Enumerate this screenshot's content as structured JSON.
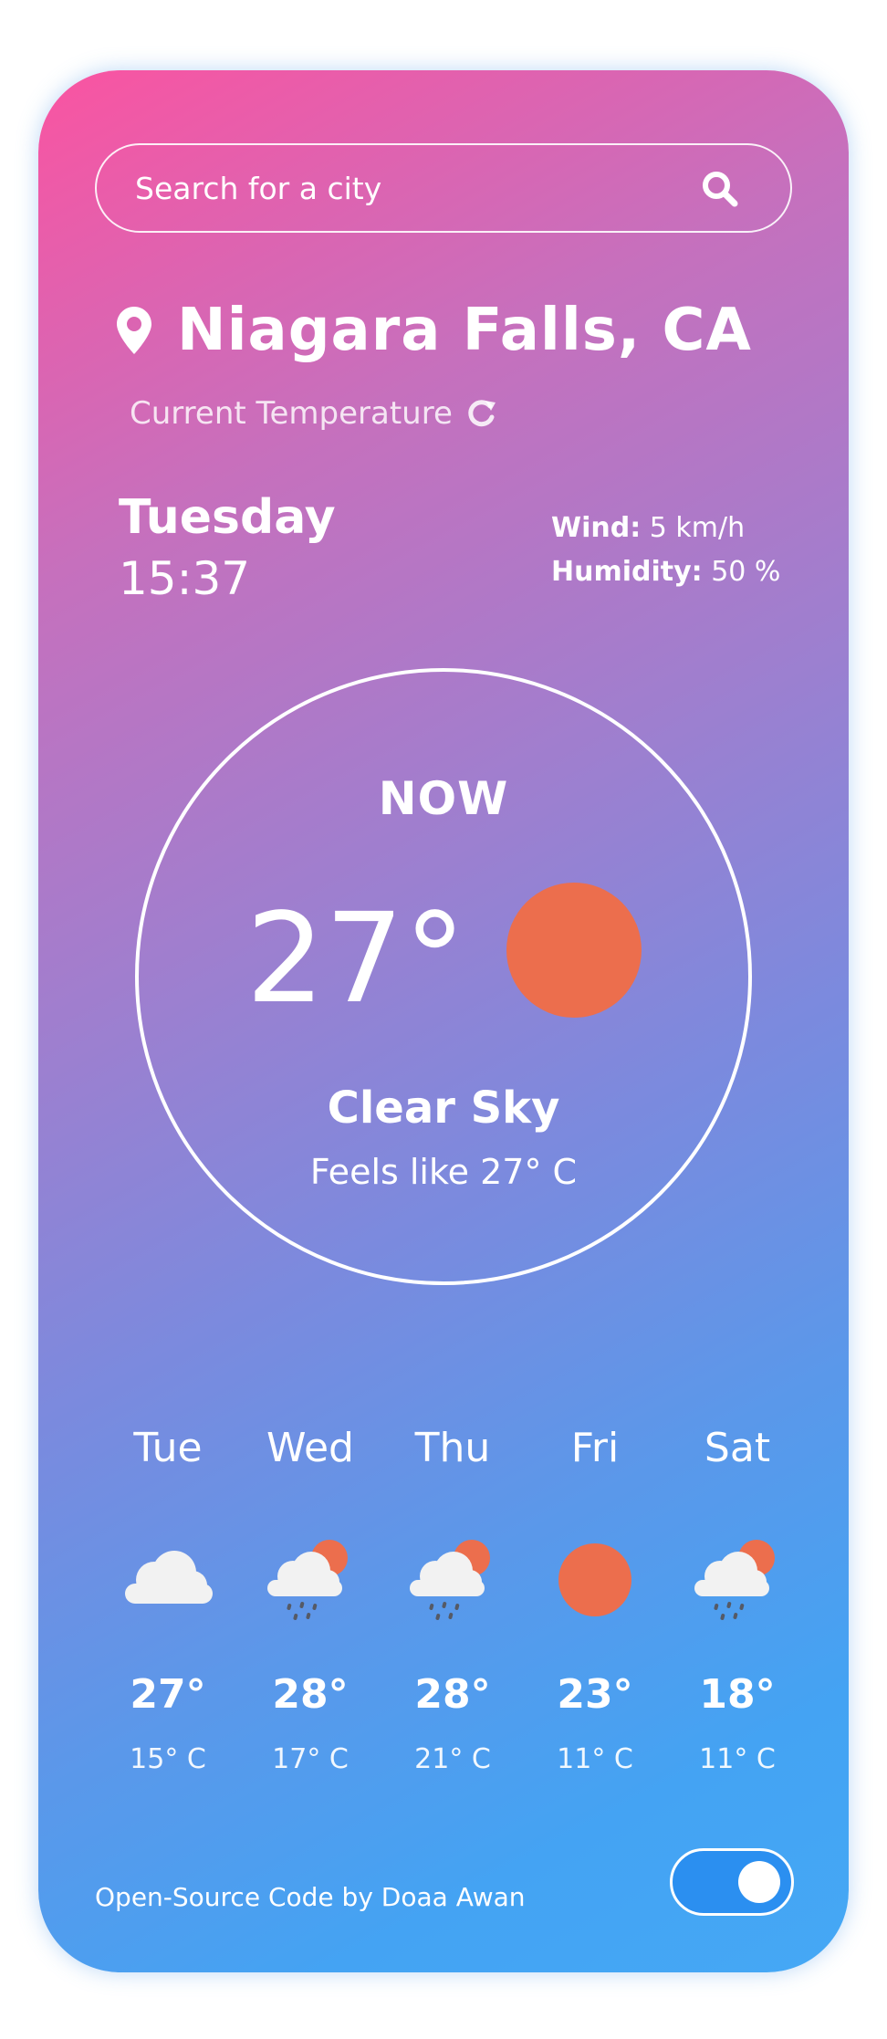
{
  "search": {
    "placeholder": "Search for a city"
  },
  "location": {
    "city": "Niagara Falls, CA",
    "label": "Current Temperature"
  },
  "datetime": {
    "day": "Tuesday",
    "time": "15:37"
  },
  "details": {
    "wind_label": "Wind:",
    "wind_value": "5 km/h",
    "humidity_label": "Humidity:",
    "humidity_value": "50 %"
  },
  "current": {
    "now_label": "NOW",
    "temp": "27°",
    "icon": "sun-icon",
    "condition": "Clear Sky",
    "feels_like": "Feels like 27° C"
  },
  "forecast": [
    {
      "day": "Tue",
      "icon": "cloud-icon",
      "high": "27°",
      "low": "15° C"
    },
    {
      "day": "Wed",
      "icon": "sun-cloud-rain-icon",
      "high": "28°",
      "low": "17° C"
    },
    {
      "day": "Thu",
      "icon": "sun-cloud-rain-icon",
      "high": "28°",
      "low": "21° C"
    },
    {
      "day": "Fri",
      "icon": "sun-icon",
      "high": "23°",
      "low": "11° C"
    },
    {
      "day": "Sat",
      "icon": "sun-cloud-rain-icon",
      "high": "18°",
      "low": "11° C"
    }
  ],
  "footer": {
    "credit": "Open-Source Code by Doaa Awan",
    "toggle_on": true
  },
  "colors": {
    "gradient_start": "#fa54a1",
    "gradient_end": "#45a8f5",
    "sun": "#ec6e4d",
    "cloud": "#f2f2f2",
    "toggle": "#2b8ff0"
  }
}
